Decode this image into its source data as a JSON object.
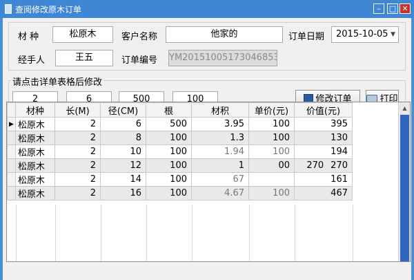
{
  "window": {
    "title": "查阅修改原木订单",
    "min_label": "–",
    "max_label": "□",
    "close_label": "✕"
  },
  "form": {
    "material_label": "材  种",
    "material_value": "松原木",
    "customer_label": "客户名称",
    "customer_value": "他家的",
    "date_label": "订单日期",
    "date_value": "2015-10-05",
    "handler_label": "经手人",
    "handler_value": "王五",
    "order_no_label": "订单编号",
    "order_no_value": "YM20151005173046853"
  },
  "edit_group": {
    "legend": "请点击详单表格后修改",
    "values": [
      "2",
      "6",
      "500",
      "100"
    ],
    "modify_button": "修改订单",
    "print_button": "打印"
  },
  "table": {
    "columns": [
      "材种",
      "长(M)",
      "径(CM)",
      "根",
      "材积",
      "单价(元)",
      "价值(元)"
    ],
    "current_row_marker": "▶",
    "rows": [
      [
        "松原木",
        "2",
        "6",
        "500",
        "3.95",
        "100",
        "395"
      ],
      [
        "松原木",
        "2",
        "8",
        "100",
        "1.3",
        "100",
        "130"
      ],
      [
        "松原木",
        "2",
        "10",
        "100",
        "1.94",
        "100",
        "194"
      ],
      [
        "松原木",
        "2",
        "12",
        "100",
        "1",
        "00",
        "270"
      ],
      [
        "松原木",
        "2",
        "14",
        "100",
        "67",
        "",
        "161"
      ],
      [
        "松原木",
        "2",
        "16",
        "100",
        "4.67",
        "100",
        "467"
      ]
    ],
    "stray_value": "270"
  },
  "icons": {
    "window": "app-icon",
    "save": "floppy-disk-icon",
    "print": "printer-icon"
  }
}
